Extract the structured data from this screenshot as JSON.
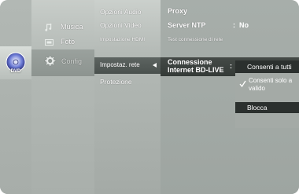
{
  "device_tab": {
    "label": "DVD",
    "icon": "disc-icon"
  },
  "main_menu": {
    "items": [
      {
        "label": "Musica",
        "icon": "music-note-icon"
      },
      {
        "label": "Foto",
        "icon": "photo-icon"
      },
      {
        "label": "Config",
        "icon": "gear-icon",
        "selected": true
      }
    ]
  },
  "sub_menu": {
    "items": [
      {
        "label": "Opzioni Audio"
      },
      {
        "label": "Opzioni Video"
      },
      {
        "label": "Impostazione HDMI"
      },
      {
        "label": "Impostaz. rete",
        "selected": true
      },
      {
        "label": "Protezione"
      }
    ]
  },
  "detail": {
    "proxy_label": "Proxy",
    "ntp_label": "Server NTP",
    "ntp_colon": ":",
    "ntp_value": "No",
    "test_label": "Test connessione di rete",
    "bdlive_label_line1": "Connessione",
    "bdlive_label_line2": "Internet BD-LIVE",
    "bdlive_colon": ":"
  },
  "popup": {
    "options": [
      {
        "label": "Consenti a tutti",
        "highlighted": true
      },
      {
        "label": "Consenti solo a valido",
        "checked": true
      },
      {
        "label": "Blocca",
        "highlighted": true
      }
    ]
  },
  "colors": {
    "highlight_dark": "#2b302e",
    "panel_gray": "#a4aaa6",
    "text": "#ffffff"
  }
}
